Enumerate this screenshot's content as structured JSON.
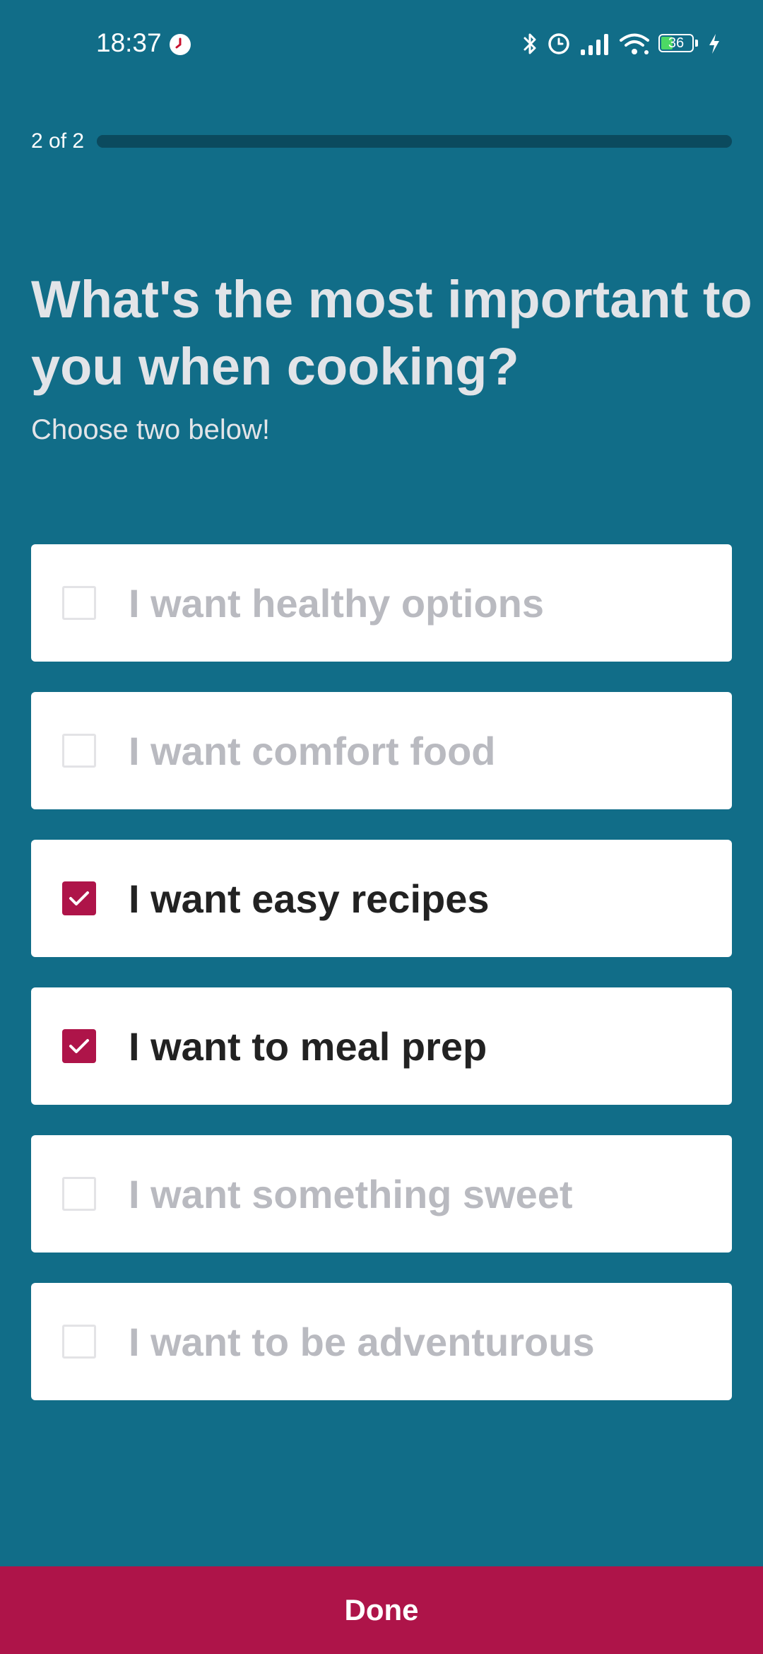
{
  "status_bar": {
    "time": "18:37",
    "battery_level": "36",
    "icons": [
      "app-notification-icon",
      "bluetooth-icon",
      "alarm-icon",
      "signal-icon",
      "wifi-icon",
      "battery-icon",
      "charging-icon"
    ]
  },
  "progress": {
    "label": "2 of 2",
    "value": 1.0
  },
  "question": {
    "line1": "What's the most important to",
    "line2": "you when cooking?",
    "subtitle": "Choose two below!"
  },
  "options": [
    {
      "label": "I want healthy options",
      "checked": false
    },
    {
      "label": "I want comfort food",
      "checked": false
    },
    {
      "label": "I want easy recipes",
      "checked": true
    },
    {
      "label": "I want to meal prep",
      "checked": true
    },
    {
      "label": "I want something sweet",
      "checked": false
    },
    {
      "label": "I want to be adventurous",
      "checked": false
    }
  ],
  "done_button": {
    "label": "Done"
  },
  "colors": {
    "background": "#116d88",
    "accent": "#ae1449",
    "option_unchecked_text": "#b9bac0",
    "option_checked_text": "#222222",
    "battery_fill": "#4cd964"
  }
}
